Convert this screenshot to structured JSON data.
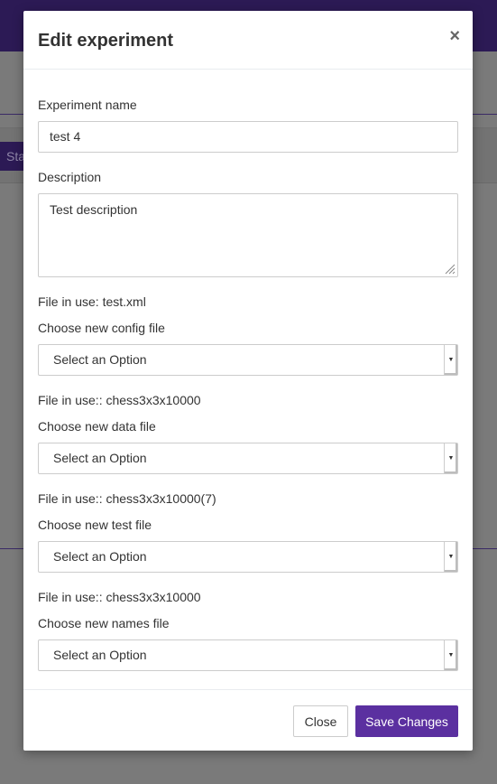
{
  "background": {
    "tab_label": "Sta"
  },
  "modal": {
    "title": "Edit experiment",
    "close_icon": "close-icon",
    "name_label": "Experiment name",
    "name_value": "test 4",
    "description_label": "Description",
    "description_value": "Test description",
    "config": {
      "in_use": "File in use: test.xml",
      "label": "Choose new config file",
      "selected": "Select an Option"
    },
    "data": {
      "in_use": "File in use:: chess3x3x10000",
      "label": "Choose new data file",
      "selected": "Select an Option"
    },
    "test": {
      "in_use": "File in use:: chess3x3x10000(7)",
      "label": "Choose new test file",
      "selected": "Select an Option"
    },
    "names": {
      "in_use": "File in use:: chess3x3x10000",
      "label": "Choose new names file",
      "selected": "Select an Option"
    },
    "footer": {
      "close_label": "Close",
      "save_label": "Save Changes"
    }
  },
  "colors": {
    "accent": "#5b30a0",
    "topbar": "#2c1a55",
    "overlay": "#7a7a7a"
  }
}
